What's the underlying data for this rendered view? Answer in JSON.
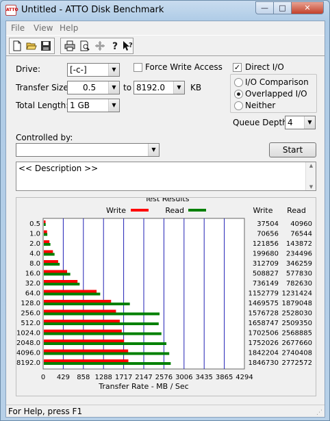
{
  "window": {
    "title": "Untitled - ATTO Disk Benchmark",
    "app_icon_text": "ATTO"
  },
  "controls": {
    "minimize": "—",
    "maximize": "□",
    "close": "✕"
  },
  "menu": [
    {
      "label": "File"
    },
    {
      "label": "View"
    },
    {
      "label": "Help"
    }
  ],
  "toolbar_icons": [
    "new-document-icon",
    "open-folder-icon",
    "save-icon",
    "print-icon",
    "print-preview-icon",
    "move-icon",
    "help-icon",
    "context-help-icon"
  ],
  "form": {
    "drive_label": "Drive:",
    "drive_value": "[-c-]",
    "force_write_label": "Force Write Access",
    "force_write_checked": false,
    "direct_io_label": "Direct I/O",
    "direct_io_checked": true,
    "transfer_size_label": "Transfer Size:",
    "transfer_from": "0.5",
    "to_label": "to",
    "transfer_to": "8192.0",
    "kb_label": "KB",
    "total_length_label": "Total Length:",
    "total_length_value": "1 GB",
    "radio_io_comparison": "I/O Comparison",
    "radio_overlapped": "Overlapped I/O",
    "radio_neither": "Neither",
    "selected_radio": "Overlapped I/O",
    "queue_depth_label": "Queue Depth:",
    "queue_depth_value": "4",
    "controlled_by_label": "Controlled by:",
    "controlled_by_value": "",
    "start_label": "Start",
    "description_text": "<< Description >>"
  },
  "results": {
    "title": "Test Results",
    "legend_write": "Write",
    "legend_read": "Read",
    "col_write": "Write",
    "col_read": "Read",
    "write_color": "#ff0000",
    "read_color": "#008000"
  },
  "chart_data": {
    "type": "bar",
    "orientation": "horizontal",
    "title": "Test Results",
    "xlabel": "Transfer Rate - MB / Sec",
    "xticks": [
      "0",
      "429",
      "858",
      "1288",
      "1717",
      "2147",
      "2576",
      "3006",
      "3435",
      "3865",
      "4294"
    ],
    "xlim": [
      0,
      4294
    ],
    "categories": [
      "0.5",
      "1.0",
      "2.0",
      "4.0",
      "8.0",
      "16.0",
      "32.0",
      "64.0",
      "128.0",
      "256.0",
      "512.0",
      "1024.0",
      "2048.0",
      "4096.0",
      "8192.0"
    ],
    "series": [
      {
        "name": "Write",
        "color": "#ff0000",
        "values": [
          37504,
          70656,
          121856,
          199680,
          312709,
          508827,
          736149,
          1152779,
          1469575,
          1576728,
          1658747,
          1702506,
          1752026,
          1842204,
          1846730
        ]
      },
      {
        "name": "Read",
        "color": "#008000",
        "values": [
          40960,
          76544,
          143872,
          234496,
          346259,
          577830,
          782630,
          1231424,
          1879048,
          2528030,
          2509350,
          2568885,
          2677660,
          2740408,
          2772572
        ]
      }
    ],
    "grid": true
  },
  "status": {
    "text": "For Help, press F1"
  }
}
